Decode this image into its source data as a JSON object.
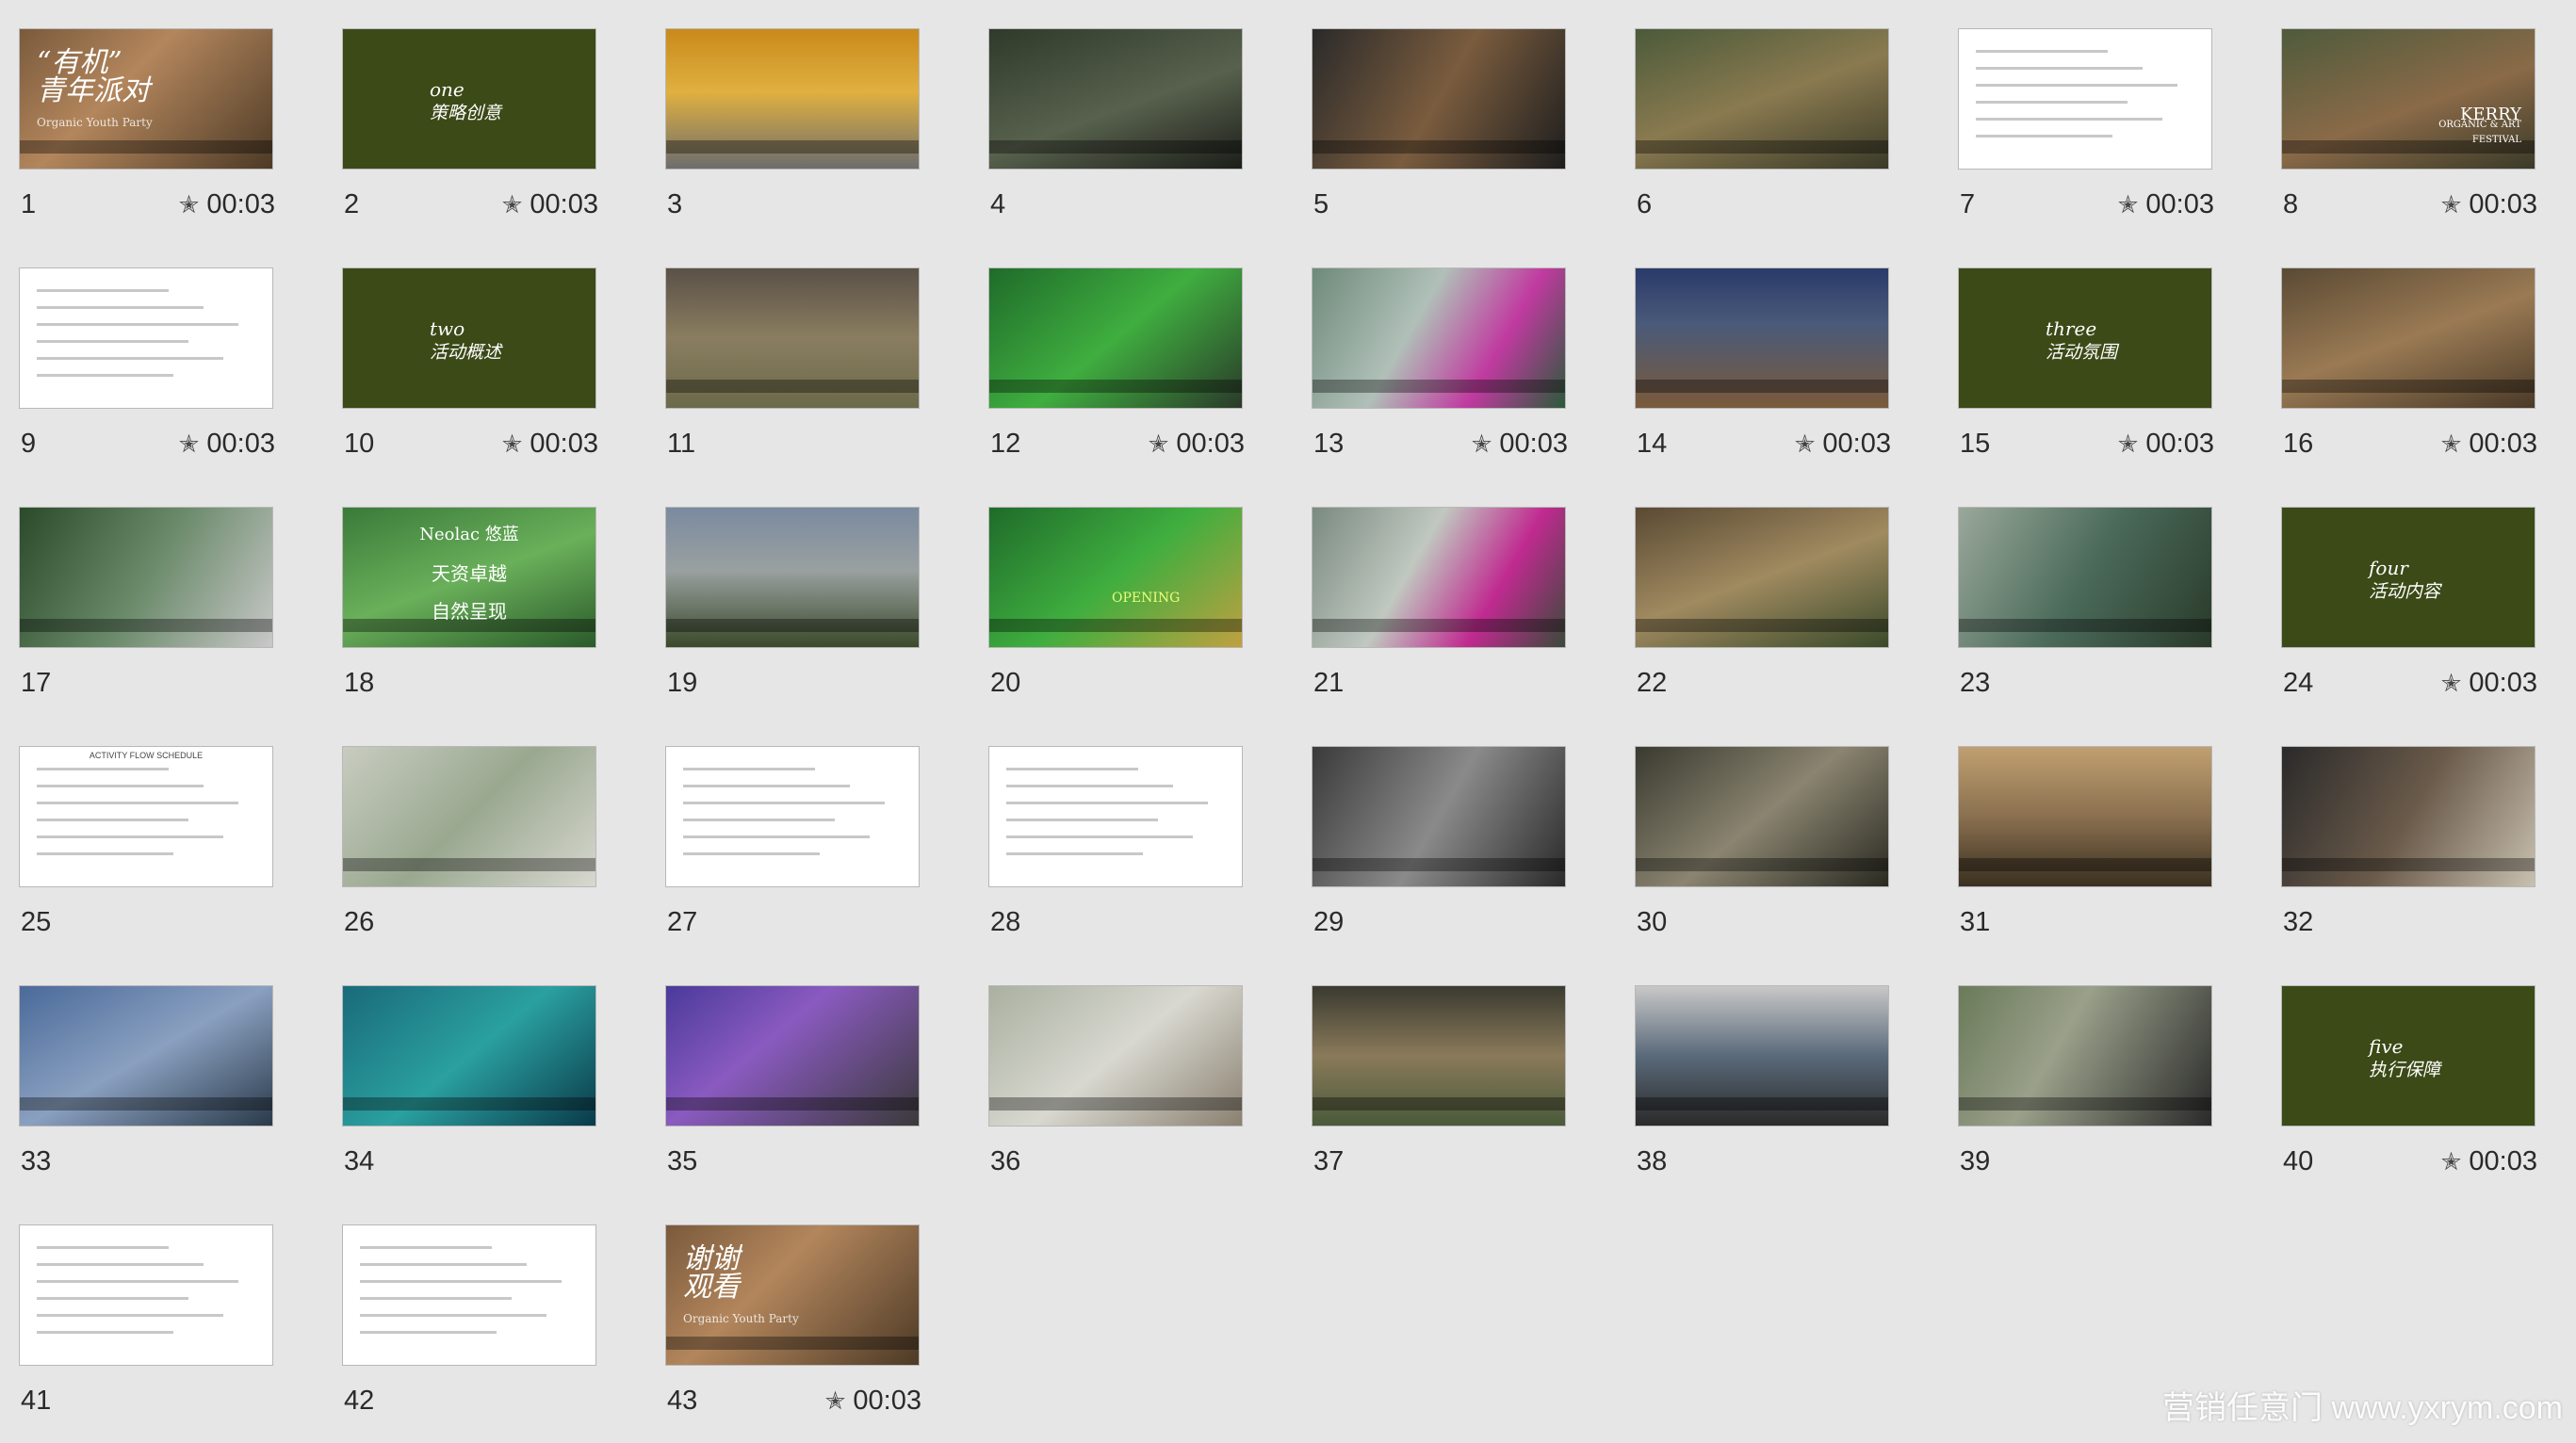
{
  "slides": [
    {
      "number": "1",
      "timing": "00:03",
      "style": "photo",
      "bg": "linear-gradient(135deg,#7a5a3c 0%,#b3865c 40%,#4d3a26 100%)",
      "lines": [
        "“有机”",
        "青年派对",
        "Organic Youth Party"
      ]
    },
    {
      "number": "2",
      "timing": "00:03",
      "style": "solid",
      "bg": "#3b4a17",
      "lines": [
        "one",
        "策略创意"
      ]
    },
    {
      "number": "3",
      "timing": "",
      "style": "photo",
      "bg": "linear-gradient(180deg,#c98a1a 0%,#e0b040 45%,#6d6d6d 100%)",
      "lines": []
    },
    {
      "number": "4",
      "timing": "",
      "style": "photo",
      "bg": "linear-gradient(160deg,#2f3a2a 0%,#58614d 55%,#1c1f1a 100%)",
      "lines": []
    },
    {
      "number": "5",
      "timing": "",
      "style": "photo",
      "bg": "linear-gradient(120deg,#2a2a2a 0%,#7a5c3e 50%,#1e1e1e 100%)",
      "lines": []
    },
    {
      "number": "6",
      "timing": "",
      "style": "photo",
      "bg": "linear-gradient(160deg,#4b5a3a 0%,#8a7a50 50%,#3a3a28 100%)",
      "lines": []
    },
    {
      "number": "7",
      "timing": "00:03",
      "style": "white",
      "bg": "#ffffff",
      "lines": []
    },
    {
      "number": "8",
      "timing": "00:03",
      "style": "photo",
      "bg": "linear-gradient(160deg,#4e5b3c 0%,#8a6a48 55%,#3a3a28 100%)",
      "lines": [
        "KERRY",
        "ORGANIC & ART",
        "FESTIVAL"
      ]
    },
    {
      "number": "9",
      "timing": "00:03",
      "style": "white",
      "bg": "#ffffff",
      "lines": []
    },
    {
      "number": "10",
      "timing": "00:03",
      "style": "solid",
      "bg": "#3b4a17",
      "lines": [
        "two",
        "活动概述"
      ]
    },
    {
      "number": "11",
      "timing": "",
      "style": "photo",
      "bg": "linear-gradient(180deg,#5a5148 0%,#8a7d60 50%,#6b6a4a 100%)",
      "lines": []
    },
    {
      "number": "12",
      "timing": "00:03",
      "style": "photo",
      "bg": "linear-gradient(140deg,#1f6b2a 0%,#3fae3f 50%,#2a3a2a 100%)",
      "lines": []
    },
    {
      "number": "13",
      "timing": "00:03",
      "style": "photo",
      "bg": "linear-gradient(120deg,#6e8a7a 0%,#b0c0b8 40%,#c03aa0 70%,#2a5a3a 100%)",
      "lines": []
    },
    {
      "number": "14",
      "timing": "00:03",
      "style": "photo",
      "bg": "linear-gradient(180deg,#2a3a6a 0%,#4a5a7a 40%,#7a5a3a 100%)",
      "lines": []
    },
    {
      "number": "15",
      "timing": "00:03",
      "style": "solid",
      "bg": "#3b4a17",
      "lines": [
        "three",
        "活动氛围"
      ]
    },
    {
      "number": "16",
      "timing": "00:03",
      "style": "photo",
      "bg": "linear-gradient(160deg,#5a4a34 0%,#9a7a54 50%,#4a3a28 100%)",
      "lines": []
    },
    {
      "number": "17",
      "timing": "",
      "style": "photo",
      "bg": "linear-gradient(120deg,#2a4a2a 0%,#6a8a6a 50%,#c8c8c8 100%)",
      "lines": []
    },
    {
      "number": "18",
      "timing": "",
      "style": "photo",
      "bg": "linear-gradient(160deg,#3a7a3a 0%,#6ab05a 50%,#2a5a2a 100%)",
      "lines": [
        "Neolac 悠蓝",
        "天资卓越",
        "自然呈现"
      ]
    },
    {
      "number": "19",
      "timing": "",
      "style": "photo",
      "bg": "linear-gradient(180deg,#7a8aa0 0%,#9aa0a0 45%,#3a4a2a 100%)",
      "lines": []
    },
    {
      "number": "20",
      "timing": "",
      "style": "photo",
      "bg": "linear-gradient(140deg,#1f6b2a 0%,#3fae3f 50%,#c0a040 100%)",
      "lines": [
        "OPENING"
      ]
    },
    {
      "number": "21",
      "timing": "",
      "style": "photo",
      "bg": "linear-gradient(120deg,#7a8a80 0%,#c0c8c0 40%,#c02a90 70%,#3a4a3a 100%)",
      "lines": []
    },
    {
      "number": "22",
      "timing": "",
      "style": "photo",
      "bg": "linear-gradient(160deg,#5a4a34 0%,#a08a60 50%,#3a4a2a 100%)",
      "lines": []
    },
    {
      "number": "23",
      "timing": "",
      "style": "photo",
      "bg": "linear-gradient(120deg,#9aa89a 0%,#4a6a5a 50%,#2a3a2a 100%)",
      "lines": []
    },
    {
      "number": "24",
      "timing": "00:03",
      "style": "solid",
      "bg": "#3b4a17",
      "lines": [
        "four",
        "活动内容"
      ]
    },
    {
      "number": "25",
      "timing": "",
      "style": "white",
      "bg": "#ffffff",
      "lines": [
        "ACTIVITY FLOW SCHEDULE"
      ]
    },
    {
      "number": "26",
      "timing": "",
      "style": "plan",
      "bg": "linear-gradient(135deg,#c8ccc0 0%,#9aa890 50%,#d8d8d0 100%)",
      "lines": []
    },
    {
      "number": "27",
      "timing": "",
      "style": "white",
      "bg": "#ffffff",
      "lines": []
    },
    {
      "number": "28",
      "timing": "",
      "style": "white",
      "bg": "#ffffff",
      "lines": []
    },
    {
      "number": "29",
      "timing": "",
      "style": "photo",
      "bg": "linear-gradient(120deg,#3a3a3a 0%,#8a8a8a 50%,#2a2a2a 100%)",
      "lines": []
    },
    {
      "number": "30",
      "timing": "",
      "style": "photo",
      "bg": "linear-gradient(140deg,#3a3a30 0%,#8a8470 50%,#2a2a22 100%)",
      "lines": []
    },
    {
      "number": "31",
      "timing": "",
      "style": "photo",
      "bg": "linear-gradient(180deg,#c0a070 0%,#8a7050 50%,#3a3020 100%)",
      "lines": []
    },
    {
      "number": "32",
      "timing": "",
      "style": "photo",
      "bg": "linear-gradient(120deg,#2a2a2a 0%,#6a5a4a 50%,#c8c0b0 100%)",
      "lines": []
    },
    {
      "number": "33",
      "timing": "",
      "style": "photo",
      "bg": "linear-gradient(150deg,#4a6a9a 0%,#8aa0c0 50%,#2a3a4a 100%)",
      "lines": []
    },
    {
      "number": "34",
      "timing": "",
      "style": "photo",
      "bg": "linear-gradient(140deg,#1a6a7a 0%,#2aa0a0 50%,#0a3a4a 100%)",
      "lines": []
    },
    {
      "number": "35",
      "timing": "",
      "style": "photo",
      "bg": "linear-gradient(140deg,#4a3a9a 0%,#8a5ac0 40%,#3a3a3a 100%)",
      "lines": []
    },
    {
      "number": "36",
      "timing": "",
      "style": "photo",
      "bg": "linear-gradient(140deg,#aab0a0 0%,#d8d8d0 50%,#8a8070 100%)",
      "lines": []
    },
    {
      "number": "37",
      "timing": "",
      "style": "photo",
      "bg": "linear-gradient(180deg,#3a3a30 0%,#8a7a5a 50%,#4a5a3a 100%)",
      "lines": []
    },
    {
      "number": "38",
      "timing": "",
      "style": "photo",
      "bg": "linear-gradient(180deg,#c8c8c8 0%,#5a6a7a 50%,#2a2a2a 100%)",
      "lines": []
    },
    {
      "number": "39",
      "timing": "",
      "style": "photo",
      "bg": "linear-gradient(120deg,#6a7a5a 0%,#9aa08a 40%,#2a2a2a 100%)",
      "lines": []
    },
    {
      "number": "40",
      "timing": "00:03",
      "style": "solid",
      "bg": "#3b4a17",
      "lines": [
        "five",
        "执行保障"
      ]
    },
    {
      "number": "41",
      "timing": "",
      "style": "white",
      "bg": "#ffffff",
      "lines": []
    },
    {
      "number": "42",
      "timing": "",
      "style": "white",
      "bg": "#ffffff",
      "lines": []
    },
    {
      "number": "43",
      "timing": "00:03",
      "style": "photo",
      "bg": "linear-gradient(135deg,#7a5a3c 0%,#b3865c 40%,#4d3a26 100%)",
      "lines": [
        "谢谢",
        "观看",
        "Organic Youth Party"
      ]
    }
  ],
  "timing_icon": "star-icon",
  "star_glyph": "✭",
  "watermark": "营销任意门 www.yxrym.com"
}
